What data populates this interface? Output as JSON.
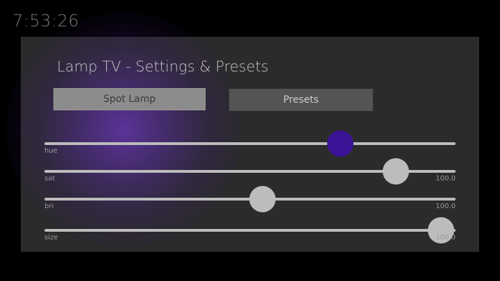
{
  "clock": "7:53:26",
  "title": "Lamp TV - Settings & Presets",
  "buttons": {
    "spot_lamp": "Spot Lamp",
    "presets": "Presets"
  },
  "colors": {
    "background": "#000000",
    "panel": "#2b2b2b",
    "hue_knob": "#3a1496",
    "knob": "#bcbcbc",
    "glow": "#6e37c8"
  },
  "sliders": [
    {
      "id": "hue",
      "label": "hue",
      "value_text": "",
      "level": 0.72
    },
    {
      "id": "sat",
      "label": "sat",
      "value_text": "100.0",
      "level": 0.855
    },
    {
      "id": "bri",
      "label": "bri",
      "value_text": "100.0",
      "level": 0.53
    },
    {
      "id": "size",
      "label": "size",
      "value_text": "100.0",
      "level": 0.965
    }
  ]
}
